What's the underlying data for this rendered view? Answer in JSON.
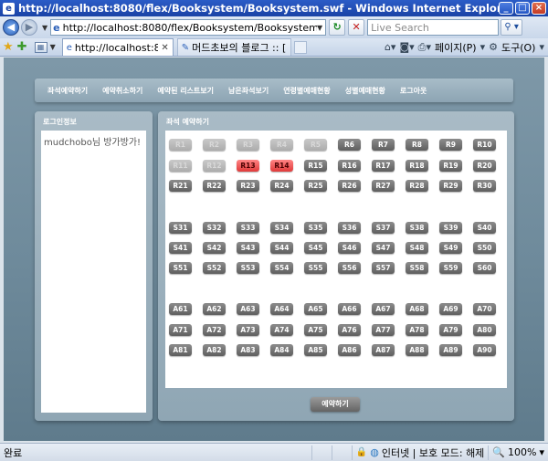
{
  "window": {
    "title": "http://localhost:8080/flex/Booksystem/Booksystem.swf - Windows Internet Explorer"
  },
  "address": {
    "url": "http://localhost:8080/flex/Booksystem/Booksystem.swf"
  },
  "search": {
    "placeholder": "Live Search"
  },
  "tabs": [
    {
      "label": "http://localhost:8080/...",
      "active": true
    },
    {
      "label": "머드초보의 블로그 :: [FL...",
      "active": false
    }
  ],
  "toolbar": {
    "page_label": "페이지(P)",
    "tools_label": "도구(O)"
  },
  "menu": [
    "좌석예약하기",
    "예약취소하기",
    "예약된 리스트보기",
    "남은좌석보기",
    "연령별예매현황",
    "성별예매현황",
    "로그아웃"
  ],
  "login_panel": {
    "title": "로그인정보",
    "text": "mudchobo님 방가방가!"
  },
  "seat_panel": {
    "title": "좌석 예약하기",
    "reserve_label": "예약하기",
    "rows": [
      {
        "seats": [
          "R1",
          "R2",
          "R3",
          "R4",
          "R5",
          "R6",
          "R7",
          "R8",
          "R9",
          "R10"
        ],
        "disabled": [
          0,
          1,
          2,
          3,
          4
        ],
        "selected": []
      },
      {
        "seats": [
          "R11",
          "R12",
          "R13",
          "R14",
          "R15",
          "R16",
          "R17",
          "R18",
          "R19",
          "R20"
        ],
        "disabled": [
          0,
          1
        ],
        "selected": [
          2,
          3
        ]
      },
      {
        "seats": [
          "R21",
          "R22",
          "R23",
          "R24",
          "R25",
          "R26",
          "R27",
          "R28",
          "R29",
          "R30"
        ],
        "disabled": [],
        "selected": []
      },
      {
        "seats": [
          "S31",
          "S32",
          "S33",
          "S34",
          "S35",
          "S36",
          "S37",
          "S38",
          "S39",
          "S40"
        ],
        "disabled": [],
        "selected": []
      },
      {
        "seats": [
          "S41",
          "S42",
          "S43",
          "S44",
          "S45",
          "S46",
          "S47",
          "S48",
          "S49",
          "S50"
        ],
        "disabled": [],
        "selected": []
      },
      {
        "seats": [
          "S51",
          "S52",
          "S53",
          "S54",
          "S55",
          "S56",
          "S57",
          "S58",
          "S59",
          "S60"
        ],
        "disabled": [],
        "selected": []
      },
      {
        "seats": [
          "A61",
          "A62",
          "A63",
          "A64",
          "A65",
          "A66",
          "A67",
          "A68",
          "A69",
          "A70"
        ],
        "disabled": [],
        "selected": []
      },
      {
        "seats": [
          "A71",
          "A72",
          "A73",
          "A74",
          "A75",
          "A76",
          "A77",
          "A78",
          "A79",
          "A80"
        ],
        "disabled": [],
        "selected": []
      },
      {
        "seats": [
          "A81",
          "A82",
          "A83",
          "A84",
          "A85",
          "A86",
          "A87",
          "A88",
          "A89",
          "A90"
        ],
        "disabled": [],
        "selected": []
      }
    ]
  },
  "status": {
    "left": "완료",
    "zone": "인터넷 | 보호 모드: 해제",
    "zoom": "100%"
  }
}
